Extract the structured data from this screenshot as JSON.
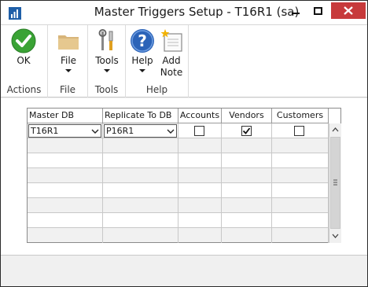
{
  "window": {
    "title": "Master Triggers Setup  -  T16R1 (sa)"
  },
  "ribbon": {
    "groups": [
      {
        "label": "Actions",
        "buttons": [
          {
            "label": "OK",
            "icon": "ok-check-icon"
          }
        ]
      },
      {
        "label": "File",
        "buttons": [
          {
            "label": "File",
            "icon": "folder-icon",
            "has_dropdown": true
          }
        ]
      },
      {
        "label": "Tools",
        "buttons": [
          {
            "label": "Tools",
            "icon": "tools-icon",
            "has_dropdown": true
          }
        ]
      },
      {
        "label": "Help",
        "buttons": [
          {
            "label": "Help",
            "icon": "help-icon",
            "has_dropdown": true
          },
          {
            "label_line1": "Add",
            "label_line2": "Note",
            "icon": "add-note-icon"
          }
        ]
      }
    ]
  },
  "grid": {
    "columns": [
      "Master DB",
      "Replicate To DB",
      "Accounts",
      "Vendors",
      "Customers"
    ],
    "rows": [
      {
        "master_db": "T16R1",
        "replicate_to_db": "P16R1",
        "accounts": false,
        "vendors": true,
        "customers": false
      }
    ]
  },
  "colors": {
    "close_button": "#c73a3b",
    "ok_green": "#3aa335",
    "help_blue": "#2b63b8",
    "folder_tan": "#d8b57a"
  }
}
